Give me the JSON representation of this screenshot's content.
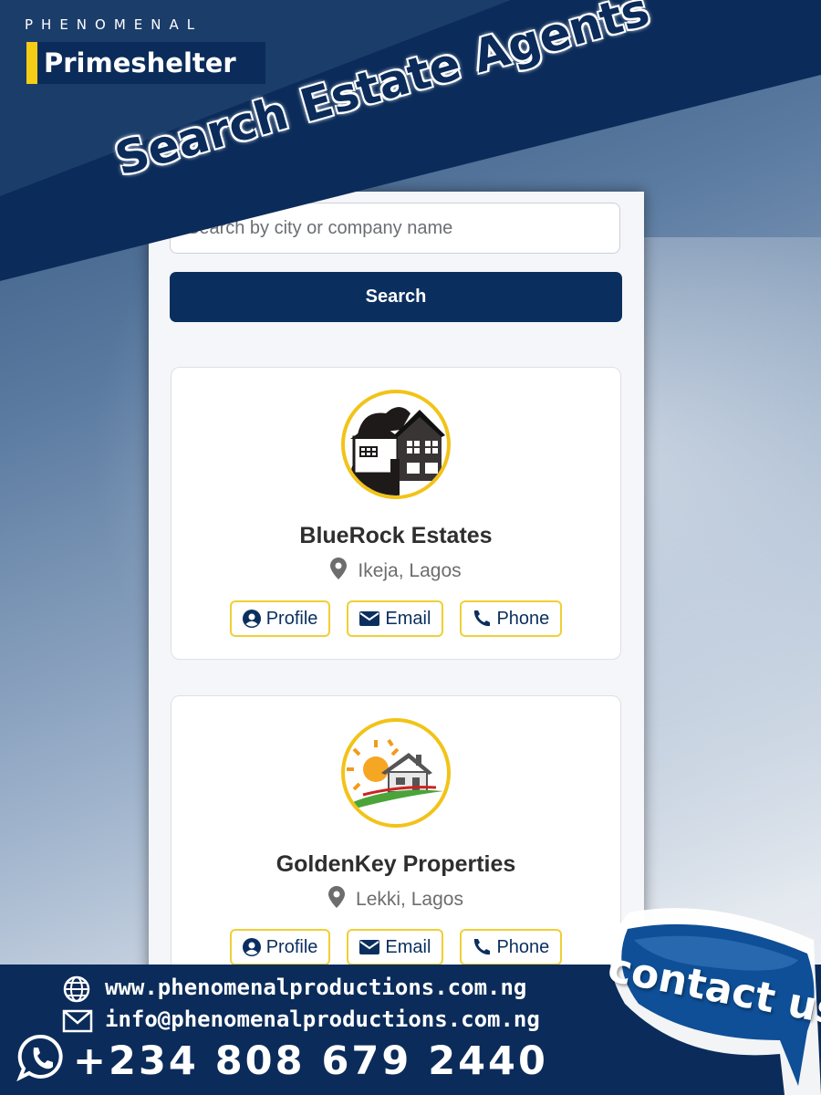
{
  "brand": {
    "tagline": "PHENOMENAL",
    "name": "Primeshelter"
  },
  "banner": {
    "title": "Search Estate Agents"
  },
  "search": {
    "placeholder": "Search by city or company name",
    "button_label": "Search"
  },
  "agents": [
    {
      "name": "BlueRock Estates",
      "location": "Ikeja, Lagos",
      "actions": {
        "profile": "Profile",
        "email": "Email",
        "phone": "Phone"
      }
    },
    {
      "name": "GoldenKey Properties",
      "location": "Lekki, Lagos",
      "actions": {
        "profile": "Profile",
        "email": "Email",
        "phone": "Phone"
      }
    }
  ],
  "footer": {
    "website": "www.phenomenalproductions.com.ng",
    "email": "info@phenomenalproductions.com.ng",
    "phone": "+234 808 679 2440",
    "contact_label": "contact us"
  },
  "colors": {
    "navy": "#0a2f5f",
    "gold": "#f2c318",
    "text_dark": "#2e2e2e",
    "text_muted": "#6d6d6d"
  },
  "icons": [
    "globe-icon",
    "mail-icon",
    "whatsapp-icon",
    "map-pin-icon",
    "user-circle-icon",
    "envelope-icon",
    "phone-icon"
  ]
}
